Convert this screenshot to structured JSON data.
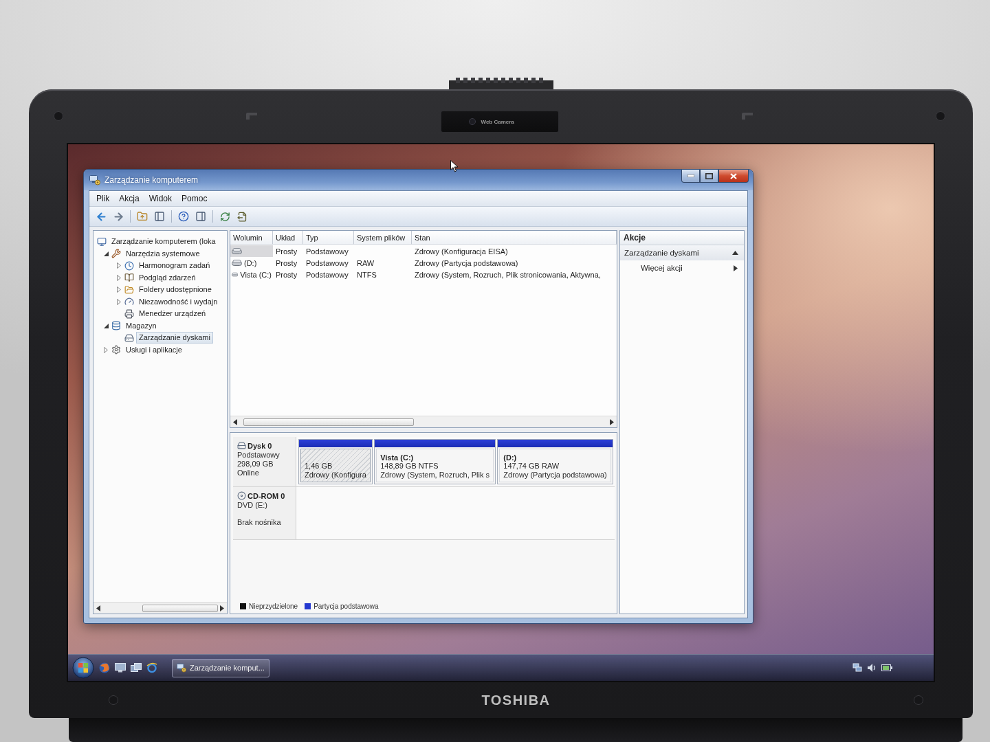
{
  "bezel": {
    "camera_label": "Web Camera",
    "brand": "TOSHIBA"
  },
  "window": {
    "title": "Zarządzanie komputerem"
  },
  "menu": [
    {
      "label": "Plik"
    },
    {
      "label": "Akcja"
    },
    {
      "label": "Widok"
    },
    {
      "label": "Pomoc"
    }
  ],
  "tree": {
    "items": [
      {
        "kind": "computer",
        "label": "Zarządzanie komputerem (loka",
        "selected": false,
        "children": [
          {
            "kind": "tools",
            "label": "Narzędzia systemowe",
            "expanded": true,
            "selected": false,
            "children": [
              {
                "kind": "clock",
                "label": "Harmonogram zadań",
                "expanded": false,
                "selected": false
              },
              {
                "kind": "log",
                "label": "Podgląd zdarzeń",
                "expanded": false,
                "selected": false
              },
              {
                "kind": "share",
                "label": "Foldery udostępnione",
                "expanded": false,
                "selected": false
              },
              {
                "kind": "monitor",
                "label": "Niezawodność i wydajn",
                "expanded": false,
                "selected": false
              },
              {
                "kind": "devices",
                "label": "Menedżer urządzeń",
                "selected": false
              }
            ]
          },
          {
            "kind": "storage",
            "label": "Magazyn",
            "expanded": true,
            "selected": false,
            "children": [
              {
                "kind": "disk",
                "label": "Zarządzanie dyskami",
                "selected": true
              }
            ]
          },
          {
            "kind": "services",
            "label": "Usługi i aplikacje",
            "expanded": false,
            "selected": false
          }
        ]
      }
    ]
  },
  "table": {
    "columns": [
      "Wolumin",
      "Układ",
      "Typ",
      "System plików",
      "Stan"
    ],
    "rows": [
      {
        "selected": true,
        "layout": "Prosty",
        "type": "Podstawowy",
        "status": "Zdrowy (Konfiguracja EISA)"
      },
      {
        "selected": false,
        "volume": "(D:)",
        "layout": "Prosty",
        "type": "Podstawowy",
        "filesystem": "RAW",
        "status": "Zdrowy (Partycja podstawowa)"
      },
      {
        "selected": false,
        "volume": "Vista (C:)",
        "layout": "Prosty",
        "type": "Podstawowy",
        "filesystem": "NTFS",
        "status": "Zdrowy (System, Rozruch, Plik stronicowania, Aktywna,"
      }
    ]
  },
  "disks": [
    {
      "kind": "hdd",
      "name": "Dysk 0",
      "type": "Podstawowy",
      "size": "298,09 GB",
      "status": "Online",
      "partitions": [
        {
          "selected": true,
          "size": "1,46 GB",
          "status": "Zdrowy (Konfigura"
        },
        {
          "selected": false,
          "label": "Vista (C:)",
          "size": "148,89 GB NTFS",
          "status": "Zdrowy (System, Rozruch, Plik s"
        },
        {
          "selected": false,
          "label": "(D:)",
          "size": "147,74 GB RAW",
          "status": "Zdrowy (Partycja podstawowa)"
        }
      ]
    },
    {
      "kind": "cdrom",
      "name": "CD-ROM 0",
      "type": "DVD (E:)",
      "status": "Brak nośnika"
    }
  ],
  "legend": [
    {
      "label": "Nieprzydzielone",
      "color": "#111111"
    },
    {
      "label": "Partycja podstawowa",
      "color": "#2438d0"
    }
  ],
  "actions": {
    "title": "Akcje",
    "items": [
      {
        "kind": "section",
        "label": "Zarządzanie dyskami",
        "expanded": true
      },
      {
        "kind": "link",
        "label": "Więcej akcji"
      }
    ]
  },
  "taskbar": {
    "buttons": [
      {
        "label": "Zarządzanie komput..."
      }
    ]
  }
}
